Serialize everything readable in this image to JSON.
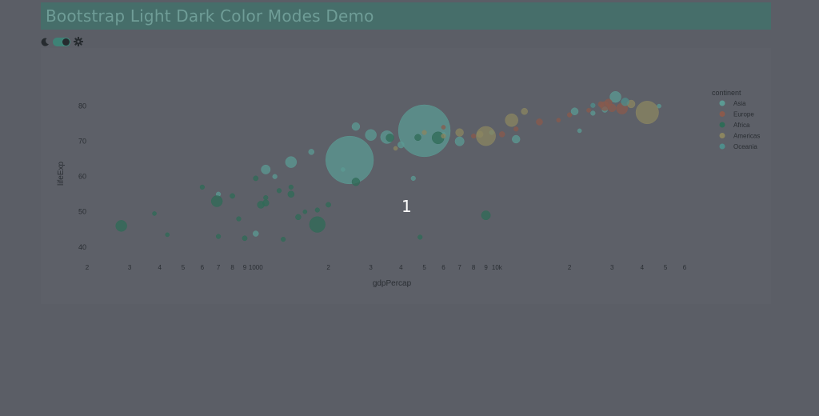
{
  "header": {
    "title": "Bootstrap Light Dark Color Modes Demo"
  },
  "controls": {
    "moon_icon": "moon-icon",
    "gear_icon": "gear-icon"
  },
  "overlay": {
    "count_label": "1"
  },
  "colors": {
    "Asia": "#5b9a93",
    "Europe": "#8a5a4c",
    "Africa": "#2f6b57",
    "Americas": "#8b8560",
    "Oceania": "#4f8d8b"
  },
  "chart_data": {
    "type": "scatter",
    "xlabel": "gdpPercap",
    "ylabel": "lifeExp",
    "xscale": "log",
    "xlim": [
      200,
      60000
    ],
    "ylim": [
      37,
      84
    ],
    "x_ticks": [
      {
        "value": 200,
        "label": "2"
      },
      {
        "value": 300,
        "label": "3"
      },
      {
        "value": 400,
        "label": "4"
      },
      {
        "value": 500,
        "label": "5"
      },
      {
        "value": 600,
        "label": "6"
      },
      {
        "value": 700,
        "label": "7"
      },
      {
        "value": 800,
        "label": "8"
      },
      {
        "value": 900,
        "label": "9"
      },
      {
        "value": 1000,
        "label": "1000"
      },
      {
        "value": 2000,
        "label": "2"
      },
      {
        "value": 3000,
        "label": "3"
      },
      {
        "value": 4000,
        "label": "4"
      },
      {
        "value": 5000,
        "label": "5"
      },
      {
        "value": 6000,
        "label": "6"
      },
      {
        "value": 7000,
        "label": "7"
      },
      {
        "value": 8000,
        "label": "8"
      },
      {
        "value": 9000,
        "label": "9"
      },
      {
        "value": 10000,
        "label": "10k"
      },
      {
        "value": 20000,
        "label": "2"
      },
      {
        "value": 30000,
        "label": "3"
      },
      {
        "value": 40000,
        "label": "4"
      },
      {
        "value": 50000,
        "label": "5"
      },
      {
        "value": 60000,
        "label": "6"
      }
    ],
    "y_ticks": [
      {
        "value": 40,
        "label": "40"
      },
      {
        "value": 50,
        "label": "50"
      },
      {
        "value": 60,
        "label": "60"
      },
      {
        "value": 70,
        "label": "70"
      },
      {
        "value": 80,
        "label": "80"
      }
    ],
    "grid": false,
    "legend": {
      "title": "continent",
      "placement": "top-right",
      "entries": [
        "Asia",
        "Europe",
        "Africa",
        "Americas",
        "Oceania"
      ]
    },
    "series": [
      {
        "name": "Asia",
        "points": [
          {
            "x": 2450,
            "y": 64.7,
            "size": 1100
          },
          {
            "x": 5000,
            "y": 73.0,
            "size": 1300
          },
          {
            "x": 3500,
            "y": 71.2,
            "size": 80
          },
          {
            "x": 3000,
            "y": 71.8,
            "size": 60
          },
          {
            "x": 1400,
            "y": 64.1,
            "size": 60
          },
          {
            "x": 2600,
            "y": 74.2,
            "size": 30
          },
          {
            "x": 1100,
            "y": 62.0,
            "size": 40
          },
          {
            "x": 1700,
            "y": 67.0,
            "size": 15
          },
          {
            "x": 4000,
            "y": 69.0,
            "size": 20
          },
          {
            "x": 700,
            "y": 55.0,
            "size": 10
          },
          {
            "x": 1000,
            "y": 43.8,
            "size": 15
          },
          {
            "x": 12000,
            "y": 70.6,
            "size": 30
          },
          {
            "x": 21000,
            "y": 78.5,
            "size": 25
          },
          {
            "x": 31000,
            "y": 82.6,
            "size": 60
          },
          {
            "x": 28000,
            "y": 79.0,
            "size": 15
          },
          {
            "x": 25000,
            "y": 78.0,
            "size": 10
          },
          {
            "x": 47000,
            "y": 80.0,
            "size": 8
          },
          {
            "x": 22000,
            "y": 73.0,
            "size": 8
          },
          {
            "x": 4500,
            "y": 59.5,
            "size": 10
          },
          {
            "x": 7000,
            "y": 70.0,
            "size": 40
          },
          {
            "x": 6000,
            "y": 72.0,
            "size": 10
          },
          {
            "x": 9500,
            "y": 72.5,
            "size": 10
          },
          {
            "x": 1200,
            "y": 60.0,
            "size": 10
          },
          {
            "x": 2300,
            "y": 62.0,
            "size": 8
          }
        ]
      },
      {
        "name": "Europe",
        "points": [
          {
            "x": 28000,
            "y": 80.0,
            "size": 40
          },
          {
            "x": 30000,
            "y": 79.5,
            "size": 30
          },
          {
            "x": 33000,
            "y": 79.3,
            "size": 60
          },
          {
            "x": 29000,
            "y": 81.0,
            "size": 25
          },
          {
            "x": 27000,
            "y": 80.5,
            "size": 15
          },
          {
            "x": 15000,
            "y": 75.5,
            "size": 20
          },
          {
            "x": 10500,
            "y": 72.0,
            "size": 15
          },
          {
            "x": 12000,
            "y": 73.5,
            "size": 10
          },
          {
            "x": 20000,
            "y": 77.5,
            "size": 10
          },
          {
            "x": 35000,
            "y": 80.7,
            "size": 10
          },
          {
            "x": 8000,
            "y": 71.5,
            "size": 10
          },
          {
            "x": 18000,
            "y": 76.0,
            "size": 8
          },
          {
            "x": 24000,
            "y": 78.8,
            "size": 8
          },
          {
            "x": 6000,
            "y": 74.0,
            "size": 8
          }
        ]
      },
      {
        "name": "Africa",
        "points": [
          {
            "x": 277,
            "y": 46.0,
            "size": 60
          },
          {
            "x": 850,
            "y": 48.0,
            "size": 10
          },
          {
            "x": 1800,
            "y": 46.4,
            "size": 120
          },
          {
            "x": 1050,
            "y": 52.0,
            "size": 25
          },
          {
            "x": 1100,
            "y": 52.5,
            "size": 20
          },
          {
            "x": 690,
            "y": 53.0,
            "size": 60
          },
          {
            "x": 9000,
            "y": 49.0,
            "size": 40
          },
          {
            "x": 5700,
            "y": 71.0,
            "size": 70
          },
          {
            "x": 4700,
            "y": 71.1,
            "size": 20
          },
          {
            "x": 3600,
            "y": 71.0,
            "size": 30
          },
          {
            "x": 2600,
            "y": 58.5,
            "size": 30
          },
          {
            "x": 1400,
            "y": 55.0,
            "size": 20
          },
          {
            "x": 700,
            "y": 43.0,
            "size": 10
          },
          {
            "x": 900,
            "y": 42.5,
            "size": 12
          },
          {
            "x": 1500,
            "y": 48.5,
            "size": 15
          },
          {
            "x": 600,
            "y": 57.0,
            "size": 10
          },
          {
            "x": 430,
            "y": 43.5,
            "size": 8
          },
          {
            "x": 380,
            "y": 49.5,
            "size": 8
          },
          {
            "x": 1250,
            "y": 56.0,
            "size": 10
          },
          {
            "x": 1000,
            "y": 59.5,
            "size": 12
          },
          {
            "x": 800,
            "y": 54.5,
            "size": 12
          },
          {
            "x": 1600,
            "y": 50.0,
            "size": 8
          },
          {
            "x": 2000,
            "y": 52.0,
            "size": 12
          },
          {
            "x": 4800,
            "y": 42.8,
            "size": 10
          },
          {
            "x": 1300,
            "y": 42.2,
            "size": 10
          },
          {
            "x": 1800,
            "y": 50.5,
            "size": 10
          },
          {
            "x": 1100,
            "y": 54.0,
            "size": 10
          },
          {
            "x": 1400,
            "y": 57.0,
            "size": 10
          }
        ]
      },
      {
        "name": "Americas",
        "points": [
          {
            "x": 42000,
            "y": 78.2,
            "size": 250
          },
          {
            "x": 36000,
            "y": 80.6,
            "size": 30
          },
          {
            "x": 9000,
            "y": 71.5,
            "size": 180
          },
          {
            "x": 11500,
            "y": 76.0,
            "size": 80
          },
          {
            "x": 13000,
            "y": 78.5,
            "size": 20
          },
          {
            "x": 7000,
            "y": 72.5,
            "size": 30
          },
          {
            "x": 8500,
            "y": 72.0,
            "size": 20
          },
          {
            "x": 6000,
            "y": 71.5,
            "size": 10
          },
          {
            "x": 5000,
            "y": 72.5,
            "size": 10
          },
          {
            "x": 3800,
            "y": 68.0,
            "size": 8
          }
        ]
      },
      {
        "name": "Oceania",
        "points": [
          {
            "x": 34000,
            "y": 81.2,
            "size": 30
          },
          {
            "x": 25000,
            "y": 80.2,
            "size": 10
          }
        ]
      }
    ]
  }
}
